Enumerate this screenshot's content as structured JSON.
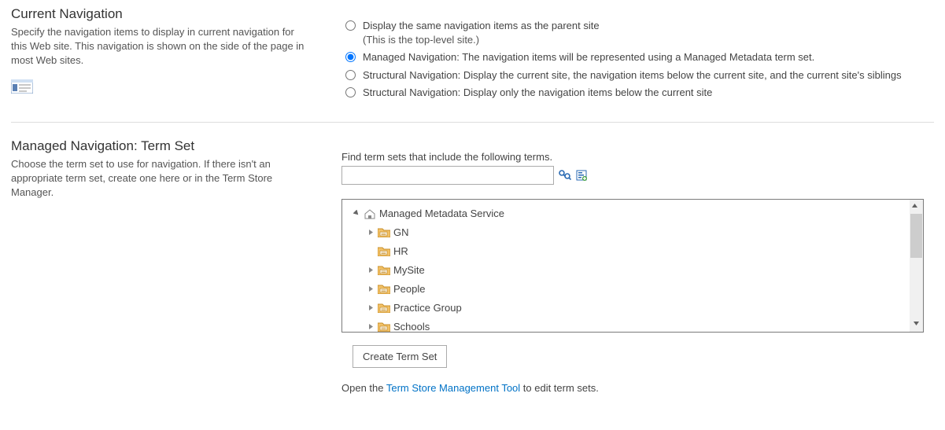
{
  "current_nav": {
    "title": "Current Navigation",
    "desc": "Specify the navigation items to display in current navigation for this Web site. This navigation is shown on the side of the page in most Web sites.",
    "options": {
      "same": "Display the same navigation items as the parent site",
      "same_sub": "(This is the top-level site.)",
      "managed": "Managed Navigation: The navigation items will be represented using a Managed Metadata term set.",
      "struct1": "Structural Navigation: Display the current site, the navigation items below the current site, and the current site's siblings",
      "struct2": "Structural Navigation: Display only the navigation items below the current site"
    }
  },
  "termset": {
    "title": "Managed Navigation: Term Set",
    "desc": "Choose the term set to use for navigation. If there isn't an appropriate term set, create one here or in the Term Store Manager.",
    "find_label": "Find term sets that include the following terms.",
    "tree": {
      "root": "Managed Metadata Service",
      "n0": "GN",
      "n1": "HR",
      "n2": "MySite",
      "n3": "People",
      "n4": "Practice Group",
      "n5": "Schools"
    },
    "create_btn": "Create Term Set",
    "open_prefix": "Open the ",
    "open_link": "Term Store Management Tool",
    "open_suffix": " to edit term sets."
  }
}
